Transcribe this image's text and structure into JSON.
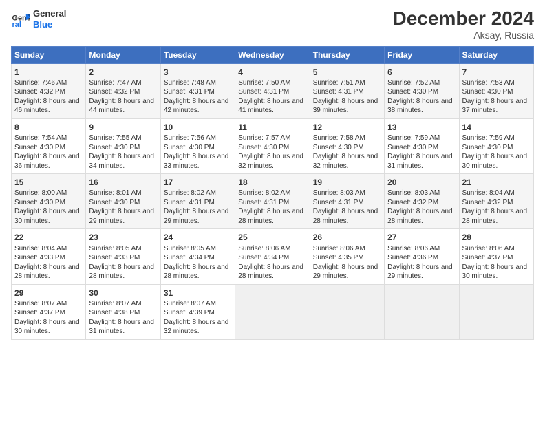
{
  "logo": {
    "line1": "General",
    "line2": "Blue"
  },
  "title": "December 2024",
  "subtitle": "Aksay, Russia",
  "days_of_week": [
    "Sunday",
    "Monday",
    "Tuesday",
    "Wednesday",
    "Thursday",
    "Friday",
    "Saturday"
  ],
  "weeks": [
    [
      {
        "day": 1,
        "sunrise": "7:46 AM",
        "sunset": "4:32 PM",
        "daylight": "8 hours and 46 minutes."
      },
      {
        "day": 2,
        "sunrise": "7:47 AM",
        "sunset": "4:32 PM",
        "daylight": "8 hours and 44 minutes."
      },
      {
        "day": 3,
        "sunrise": "7:48 AM",
        "sunset": "4:31 PM",
        "daylight": "8 hours and 42 minutes."
      },
      {
        "day": 4,
        "sunrise": "7:50 AM",
        "sunset": "4:31 PM",
        "daylight": "8 hours and 41 minutes."
      },
      {
        "day": 5,
        "sunrise": "7:51 AM",
        "sunset": "4:31 PM",
        "daylight": "8 hours and 39 minutes."
      },
      {
        "day": 6,
        "sunrise": "7:52 AM",
        "sunset": "4:30 PM",
        "daylight": "8 hours and 38 minutes."
      },
      {
        "day": 7,
        "sunrise": "7:53 AM",
        "sunset": "4:30 PM",
        "daylight": "8 hours and 37 minutes."
      }
    ],
    [
      {
        "day": 8,
        "sunrise": "7:54 AM",
        "sunset": "4:30 PM",
        "daylight": "8 hours and 36 minutes."
      },
      {
        "day": 9,
        "sunrise": "7:55 AM",
        "sunset": "4:30 PM",
        "daylight": "8 hours and 34 minutes."
      },
      {
        "day": 10,
        "sunrise": "7:56 AM",
        "sunset": "4:30 PM",
        "daylight": "8 hours and 33 minutes."
      },
      {
        "day": 11,
        "sunrise": "7:57 AM",
        "sunset": "4:30 PM",
        "daylight": "8 hours and 32 minutes."
      },
      {
        "day": 12,
        "sunrise": "7:58 AM",
        "sunset": "4:30 PM",
        "daylight": "8 hours and 32 minutes."
      },
      {
        "day": 13,
        "sunrise": "7:59 AM",
        "sunset": "4:30 PM",
        "daylight": "8 hours and 31 minutes."
      },
      {
        "day": 14,
        "sunrise": "7:59 AM",
        "sunset": "4:30 PM",
        "daylight": "8 hours and 30 minutes."
      }
    ],
    [
      {
        "day": 15,
        "sunrise": "8:00 AM",
        "sunset": "4:30 PM",
        "daylight": "8 hours and 30 minutes."
      },
      {
        "day": 16,
        "sunrise": "8:01 AM",
        "sunset": "4:30 PM",
        "daylight": "8 hours and 29 minutes."
      },
      {
        "day": 17,
        "sunrise": "8:02 AM",
        "sunset": "4:31 PM",
        "daylight": "8 hours and 29 minutes."
      },
      {
        "day": 18,
        "sunrise": "8:02 AM",
        "sunset": "4:31 PM",
        "daylight": "8 hours and 28 minutes."
      },
      {
        "day": 19,
        "sunrise": "8:03 AM",
        "sunset": "4:31 PM",
        "daylight": "8 hours and 28 minutes."
      },
      {
        "day": 20,
        "sunrise": "8:03 AM",
        "sunset": "4:32 PM",
        "daylight": "8 hours and 28 minutes."
      },
      {
        "day": 21,
        "sunrise": "8:04 AM",
        "sunset": "4:32 PM",
        "daylight": "8 hours and 28 minutes."
      }
    ],
    [
      {
        "day": 22,
        "sunrise": "8:04 AM",
        "sunset": "4:33 PM",
        "daylight": "8 hours and 28 minutes."
      },
      {
        "day": 23,
        "sunrise": "8:05 AM",
        "sunset": "4:33 PM",
        "daylight": "8 hours and 28 minutes."
      },
      {
        "day": 24,
        "sunrise": "8:05 AM",
        "sunset": "4:34 PM",
        "daylight": "8 hours and 28 minutes."
      },
      {
        "day": 25,
        "sunrise": "8:06 AM",
        "sunset": "4:34 PM",
        "daylight": "8 hours and 28 minutes."
      },
      {
        "day": 26,
        "sunrise": "8:06 AM",
        "sunset": "4:35 PM",
        "daylight": "8 hours and 29 minutes."
      },
      {
        "day": 27,
        "sunrise": "8:06 AM",
        "sunset": "4:36 PM",
        "daylight": "8 hours and 29 minutes."
      },
      {
        "day": 28,
        "sunrise": "8:06 AM",
        "sunset": "4:37 PM",
        "daylight": "8 hours and 30 minutes."
      }
    ],
    [
      {
        "day": 29,
        "sunrise": "8:07 AM",
        "sunset": "4:37 PM",
        "daylight": "8 hours and 30 minutes."
      },
      {
        "day": 30,
        "sunrise": "8:07 AM",
        "sunset": "4:38 PM",
        "daylight": "8 hours and 31 minutes."
      },
      {
        "day": 31,
        "sunrise": "8:07 AM",
        "sunset": "4:39 PM",
        "daylight": "8 hours and 32 minutes."
      },
      null,
      null,
      null,
      null
    ]
  ]
}
